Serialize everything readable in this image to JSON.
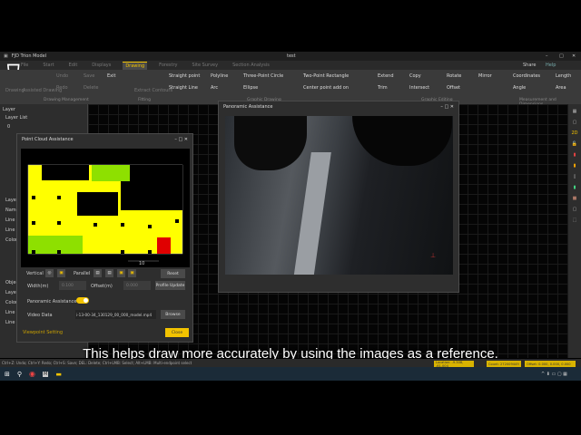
{
  "app": {
    "title": "FJD Trion Model",
    "document": "test"
  },
  "menu_tabs": [
    "File",
    "Start",
    "Edit",
    "Displays",
    "Drawing",
    "Forestry",
    "Site Survey",
    "Section Analysis"
  ],
  "active_tab": "Drawing",
  "top_right": {
    "share": "Share",
    "help": "Help"
  },
  "ribbon": {
    "drawing_management": {
      "items": [
        "Drawing",
        "Assisted Drawing",
        "Undo",
        "Redo",
        "Save",
        "Delete",
        "Exit"
      ],
      "group": "Drawing Management"
    },
    "fitting": {
      "items": [
        "Extract Contours"
      ],
      "group": "Fitting"
    },
    "graphic_drawing": {
      "items": [
        "Straight point",
        "Straight Line",
        "Polyline",
        "Arc",
        "Three-Point Circle",
        "Ellipse",
        "Two-Point Rectangle",
        "Center point add on"
      ],
      "group": "Graphic Drawing"
    },
    "graphic_editing": {
      "items": [
        "Extend",
        "Trim",
        "Copy",
        "Intersect",
        "Rotate",
        "Offset",
        "Mirror"
      ],
      "group": "Graphic Editing"
    },
    "measurement": {
      "items": [
        "Coordinates",
        "Angle",
        "Length",
        "Area"
      ],
      "group": "Measurement and Dimensions"
    }
  },
  "left_panel": {
    "title": "Layer",
    "layer_list": "Layer List",
    "layer_item": "0",
    "layer_props": {
      "title": "Layer",
      "rows": [
        "Name",
        "Line",
        "Line",
        "Color"
      ]
    },
    "object_props": {
      "title": "Object",
      "rows": [
        "Layer",
        "Color",
        "Line",
        "Line"
      ]
    }
  },
  "point_cloud_dialog": {
    "title": "Point Cloud Assistance",
    "scale_label": "10",
    "vertical": "Vertical",
    "parallel": "Parallel",
    "reset": "Reset",
    "width_label": "Width(m)",
    "width_value": "0.100",
    "offset_label": "Offset(m)",
    "offset_value": "0.000",
    "profile_update": "Profile Update",
    "panoramic_label": "Panoramic Assistance",
    "panoramic_on": true,
    "video_label": "Video Data",
    "video_value": "i-13-00-34_130129_00_000_model.mp4",
    "browse": "Browse",
    "viewpoint": "Viewpoint Setting",
    "close": "Close"
  },
  "panoramic_dialog": {
    "title": "Panoramic Assistance"
  },
  "subtitle": "This helps draw more accurately by using the images as a reference.",
  "status": {
    "hint": "Ctrl+Z: Undo; Ctrl+Y: Redo; Ctrl+S: Save; DEL: Delete; Ctrl+LMB: Select; Alt+LMB: Multi-endpoint select",
    "location": "Location: -9.308, -61.004",
    "count": "Count: 272009449",
    "offset": "Offset: 0.000, 0.000, 0.000"
  },
  "colors": {
    "accent": "#f3c300",
    "point_yellow": "#ffff00",
    "point_green": "#8ee000",
    "point_red": "#e00000"
  }
}
